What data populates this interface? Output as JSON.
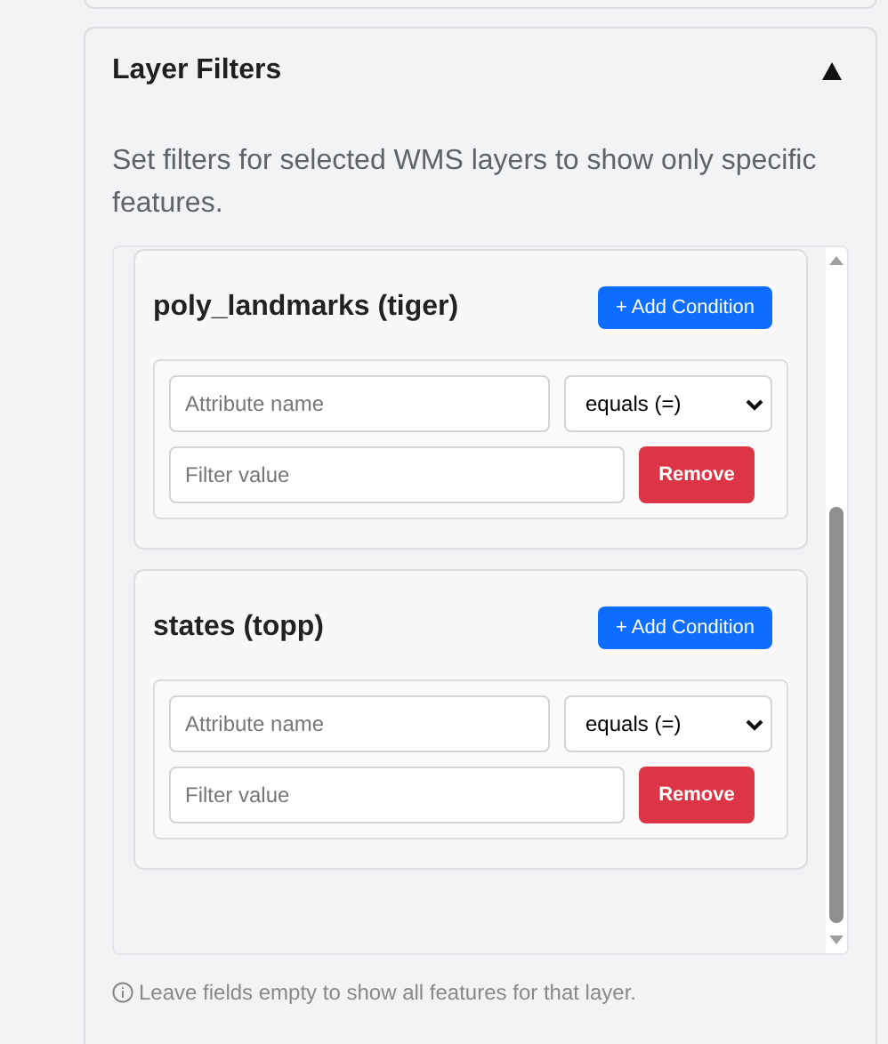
{
  "panel": {
    "title": "Layer Filters",
    "expanded": true,
    "description": "Set filters for selected WMS layers to show only specific features.",
    "layers": [
      {
        "name": "poly_landmarks (tiger)",
        "add_button": "+ Add Condition",
        "conditions": [
          {
            "attribute_placeholder": "Attribute name",
            "operator": "equals (=)",
            "value_placeholder": "Filter value",
            "remove_button": "Remove"
          }
        ]
      },
      {
        "name": "states (topp)",
        "add_button": "+ Add Condition",
        "conditions": [
          {
            "attribute_placeholder": "Attribute name",
            "operator": "equals (=)",
            "value_placeholder": "Filter value",
            "remove_button": "Remove"
          }
        ]
      }
    ],
    "hint": "Leave fields empty to show all features for that layer."
  }
}
